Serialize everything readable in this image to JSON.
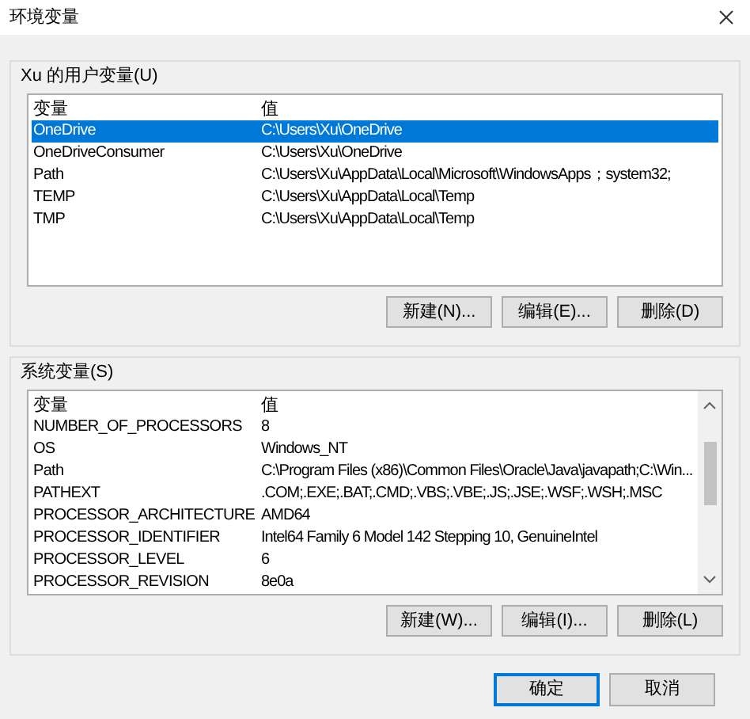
{
  "window": {
    "title": "环境变量"
  },
  "user_vars": {
    "label": "Xu 的用户变量(U)",
    "columns": [
      "变量",
      "值"
    ],
    "rows": [
      {
        "name": "OneDrive",
        "value": "C:\\Users\\Xu\\OneDrive",
        "selected": true
      },
      {
        "name": "OneDriveConsumer",
        "value": "C:\\Users\\Xu\\OneDrive",
        "selected": false
      },
      {
        "name": "Path",
        "value": "C:\\Users\\Xu\\AppData\\Local\\Microsoft\\WindowsApps；system32;",
        "selected": false
      },
      {
        "name": "TEMP",
        "value": "C:\\Users\\Xu\\AppData\\Local\\Temp",
        "selected": false
      },
      {
        "name": "TMP",
        "value": "C:\\Users\\Xu\\AppData\\Local\\Temp",
        "selected": false
      }
    ],
    "buttons": [
      "新建(N)...",
      "编辑(E)...",
      "删除(D)"
    ]
  },
  "system_vars": {
    "label": "系统变量(S)",
    "columns": [
      "变量",
      "值"
    ],
    "rows": [
      {
        "name": "NUMBER_OF_PROCESSORS",
        "value": "8",
        "selected": false
      },
      {
        "name": "OS",
        "value": "Windows_NT",
        "selected": false
      },
      {
        "name": "Path",
        "value": "C:\\Program Files (x86)\\Common Files\\Oracle\\Java\\javapath;C:\\Win...",
        "selected": false
      },
      {
        "name": "PATHEXT",
        "value": ".COM;.EXE;.BAT;.CMD;.VBS;.VBE;.JS;.JSE;.WSF;.WSH;.MSC",
        "selected": false
      },
      {
        "name": "PROCESSOR_ARCHITECTURE",
        "value": "AMD64",
        "selected": false
      },
      {
        "name": "PROCESSOR_IDENTIFIER",
        "value": "Intel64 Family 6 Model 142 Stepping 10, GenuineIntel",
        "selected": false
      },
      {
        "name": "PROCESSOR_LEVEL",
        "value": "6",
        "selected": false
      },
      {
        "name": "PROCESSOR_REVISION",
        "value": "8e0a",
        "selected": false
      }
    ],
    "buttons": [
      "新建(W)...",
      "编辑(I)...",
      "删除(L)"
    ]
  },
  "dialog_buttons": [
    {
      "label": "确定",
      "kind": "default"
    },
    {
      "label": "取消",
      "kind": "normal"
    }
  ]
}
